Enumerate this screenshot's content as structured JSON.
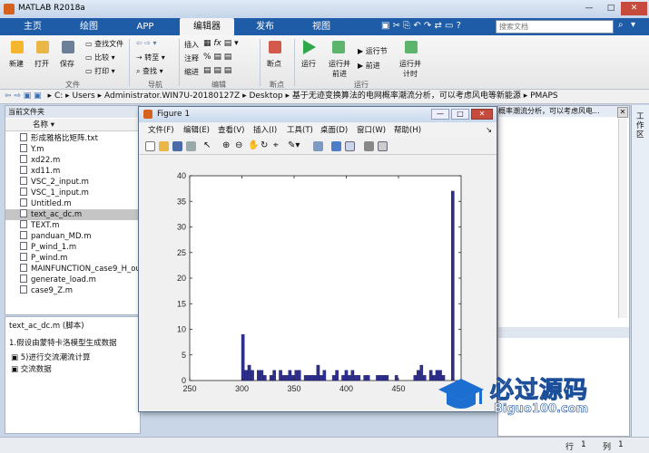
{
  "window": {
    "title": "MATLAB R2018a",
    "controls": [
      "—",
      "□",
      "✕"
    ]
  },
  "tabs": [
    {
      "label": "主页"
    },
    {
      "label": "绘图"
    },
    {
      "label": "APP"
    },
    {
      "label": "编辑器",
      "active": true
    },
    {
      "label": "发布"
    },
    {
      "label": "视图"
    }
  ],
  "search": {
    "placeholder": "搜索文档"
  },
  "ribbon": {
    "file": {
      "new": "新建",
      "open": "打开",
      "save": "保存",
      "find_file": "查找文件",
      "compare": "比较",
      "print": "打印",
      "group": "文件"
    },
    "nav": {
      "goto": "转至",
      "find": "查找",
      "group": "导航"
    },
    "edit": {
      "insert": "插入",
      "comment": "注释",
      "indent": "缩进",
      "group": "编辑"
    },
    "breakpoints": {
      "label": "断点",
      "group": "断点"
    },
    "run": {
      "run": "运行",
      "run_advance_1": "运行并",
      "run_advance_2": "前进",
      "run_section": "运行节",
      "advance": "前进",
      "run_time_1": "运行并",
      "run_time_2": "计时",
      "group": "运行"
    }
  },
  "address": {
    "segments": [
      "C:",
      "Users",
      "Administrator.WIN7U-20180127Z",
      "Desktop",
      "基于无迹变换算法的电网概率潮流分析，可以考虑风电等新能源",
      "PMAPS"
    ]
  },
  "current_folder": {
    "header": "当前文件夹",
    "column": "名称",
    "files": [
      "形成雅格比矩阵.txt",
      "Y.m",
      "xd22.m",
      "xd11.m",
      "VSC_2_input.m",
      "VSC_1_input.m",
      "Untitled.m",
      "text_ac_dc.m",
      "TEXT.m",
      "panduan_MD.m",
      "P_wind_1.m",
      "P_wind.m",
      "MAINFUNCTION_case9_H_out.m",
      "generate_load.m",
      "case9_Z.m"
    ],
    "selected_index": 7
  },
  "details": {
    "title": "text_ac_dc.m  (脚本)",
    "items": [
      "1.假设由蒙特卡洛模型生成数据",
      "5)进行交流潮流计算",
      "交流数据"
    ]
  },
  "bg_window": {
    "text": "概率潮流分析，可以考虑风电..."
  },
  "right_panel": {
    "label": "工作区"
  },
  "status": {
    "row_label": "行",
    "row": "1",
    "col_label": "列",
    "col": "1"
  },
  "figure": {
    "title": "Figure 1",
    "menu": [
      "文件(F)",
      "编辑(E)",
      "查看(V)",
      "插入(I)",
      "工具(T)",
      "桌面(D)",
      "窗口(W)",
      "帮助(H)"
    ]
  },
  "watermark": {
    "text": "必过源码",
    "url": "Biguo100.com"
  },
  "colors": {
    "accent": "#1e5ca8",
    "bar": "#2e2f8f"
  },
  "chart_data": {
    "type": "bar",
    "title": "",
    "xlabel": "",
    "ylabel": "",
    "xlim": [
      250,
      510
    ],
    "ylim": [
      0,
      40
    ],
    "xticks": [
      250,
      300,
      350,
      400,
      450
    ],
    "yticks": [
      0,
      5,
      10,
      15,
      20,
      25,
      30,
      35,
      40
    ],
    "bin_width": 2.8,
    "x": [
      301,
      304,
      307,
      310,
      313,
      316,
      319,
      322,
      325,
      328,
      331,
      334,
      337,
      340,
      343,
      346,
      349,
      352,
      355,
      358,
      361,
      364,
      367,
      370,
      373,
      376,
      379,
      382,
      385,
      388,
      391,
      394,
      397,
      400,
      403,
      406,
      409,
      412,
      415,
      418,
      421,
      424,
      427,
      430,
      433,
      436,
      439,
      442,
      445,
      448,
      451,
      454,
      457,
      460,
      463,
      466,
      469,
      472,
      475,
      478,
      481,
      484,
      487,
      490,
      493,
      496,
      499,
      502
    ],
    "values": [
      9,
      2,
      3,
      2,
      0,
      2,
      2,
      1,
      0,
      1,
      2,
      0,
      2,
      1,
      1,
      2,
      1,
      2,
      2,
      0,
      1,
      1,
      1,
      1,
      3,
      1,
      2,
      0,
      0,
      1,
      2,
      0,
      1,
      2,
      1,
      2,
      1,
      1,
      0,
      1,
      1,
      0,
      0,
      1,
      1,
      1,
      1,
      0,
      0,
      1,
      0,
      0,
      0,
      0,
      0,
      1,
      2,
      3,
      1,
      0,
      2,
      1,
      2,
      2,
      1,
      0,
      0,
      37
    ]
  }
}
